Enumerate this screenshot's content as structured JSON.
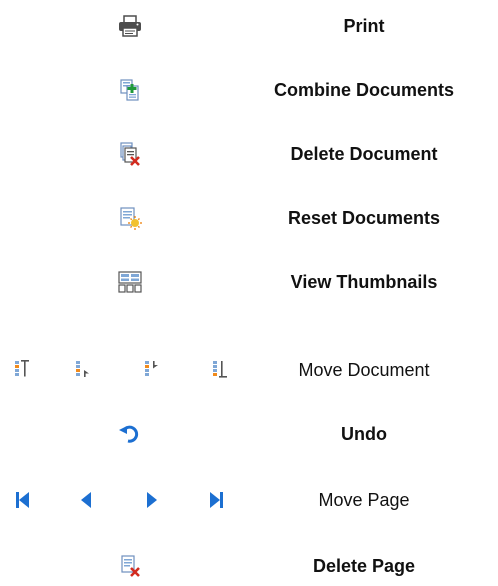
{
  "rows": [
    {
      "icon": "printer-icon",
      "label": "Print",
      "bold": true
    },
    {
      "icon": "combine-documents-icon",
      "label": "Combine Documents",
      "bold": true
    },
    {
      "icon": "delete-document-icon",
      "label": "Delete Document",
      "bold": true
    },
    {
      "icon": "reset-documents-icon",
      "label": "Reset Documents",
      "bold": true
    },
    {
      "icon": "view-thumbnails-icon",
      "label": "View Thumbnails",
      "bold": true
    },
    {
      "icons": [
        "move-to-top-icon",
        "move-up-icon",
        "move-down-icon",
        "move-to-bottom-icon"
      ],
      "label": "Move Document",
      "bold": false
    },
    {
      "icon": "undo-icon",
      "label": "Undo",
      "bold": true
    },
    {
      "icons": [
        "first-page-icon",
        "previous-page-icon",
        "next-page-icon",
        "last-page-icon"
      ],
      "label": "Move Page",
      "bold": false
    },
    {
      "icon": "delete-page-icon",
      "label": "Delete Page",
      "bold": true
    }
  ],
  "colors": {
    "printer_body": "#4d4d4d",
    "document_blue": "#7fa7d6",
    "accent_green": "#1f9a3a",
    "accent_red": "#d22b1f",
    "accent_orange": "#f08a1c",
    "accent_yellow": "#f2c12e",
    "nav_blue": "#1c6fd1"
  }
}
